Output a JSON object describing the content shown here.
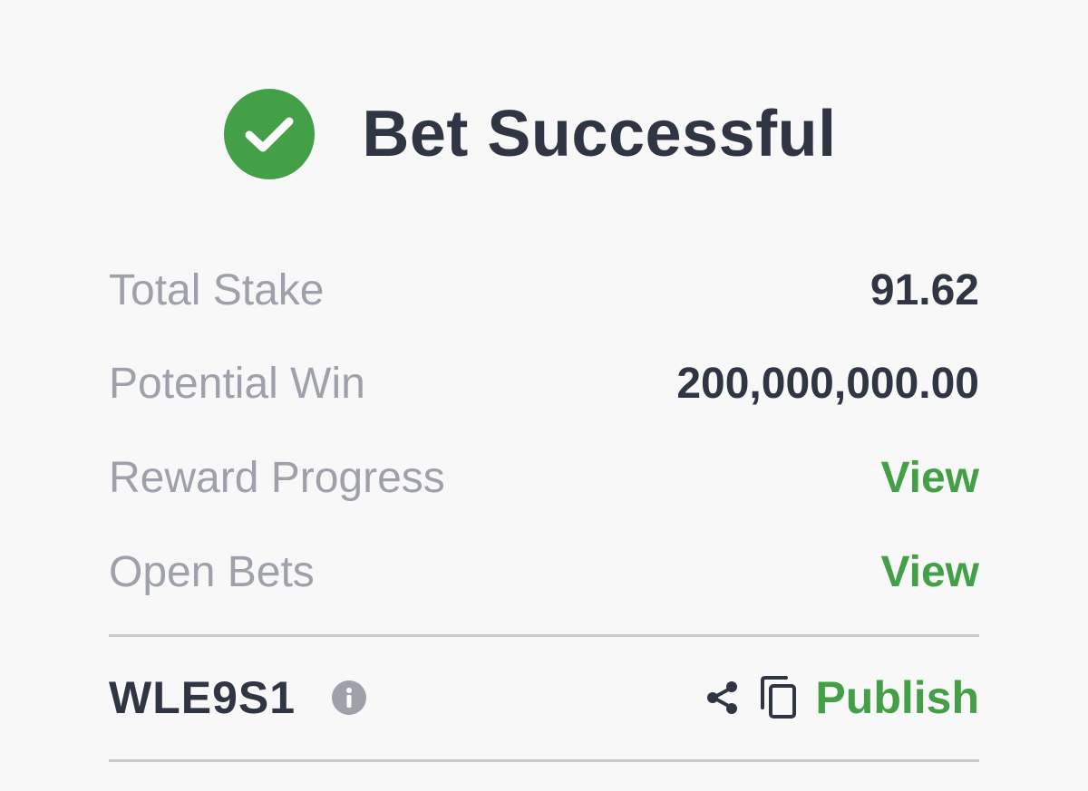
{
  "header": {
    "title": "Bet Successful",
    "icon": "check-circle-icon",
    "icon_color": "#43a047"
  },
  "summary": {
    "rows": [
      {
        "label": "Total Stake",
        "value": "91.62"
      },
      {
        "label": "Potential Win",
        "value": "200,000,000.00"
      },
      {
        "label": "Reward Progress",
        "value": "View"
      },
      {
        "label": "Open Bets",
        "value": "View"
      }
    ]
  },
  "footer": {
    "booking_code": "WLE9S1",
    "info_icon": "info-icon",
    "share_icon": "share-icon",
    "copy_icon": "copy-icon",
    "publish_label": "Publish"
  },
  "colors": {
    "accent": "#43a047",
    "text_dark": "#2f3542",
    "text_muted": "#9ea1aa",
    "background": "#f8f8f9"
  }
}
